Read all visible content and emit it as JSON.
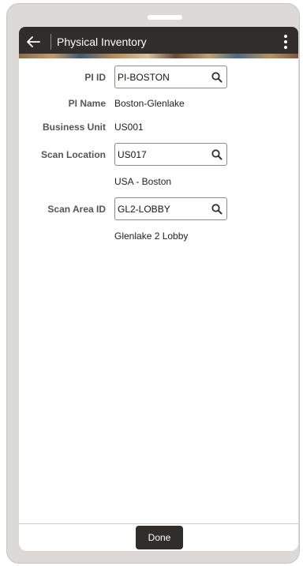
{
  "header": {
    "title": "Physical Inventory"
  },
  "form": {
    "pi_id": {
      "label": "PI ID",
      "value": "PI-BOSTON"
    },
    "pi_name": {
      "label": "PI Name",
      "value": "Boston-Glenlake"
    },
    "business_unit": {
      "label": "Business Unit",
      "value": "US001"
    },
    "scan_location": {
      "label": "Scan Location",
      "value": "US017",
      "description": "USA - Boston"
    },
    "scan_area_id": {
      "label": "Scan Area ID",
      "value": "GL2-LOBBY",
      "description": "Glenlake 2 Lobby"
    }
  },
  "footer": {
    "done_label": "Done"
  },
  "icons": {
    "back": "arrow-left-icon",
    "menu": "kebab-menu-icon",
    "search": "search-icon"
  },
  "colors": {
    "header_bg": "#312d2a",
    "button_bg": "#312d2a",
    "label_text": "#555555"
  }
}
